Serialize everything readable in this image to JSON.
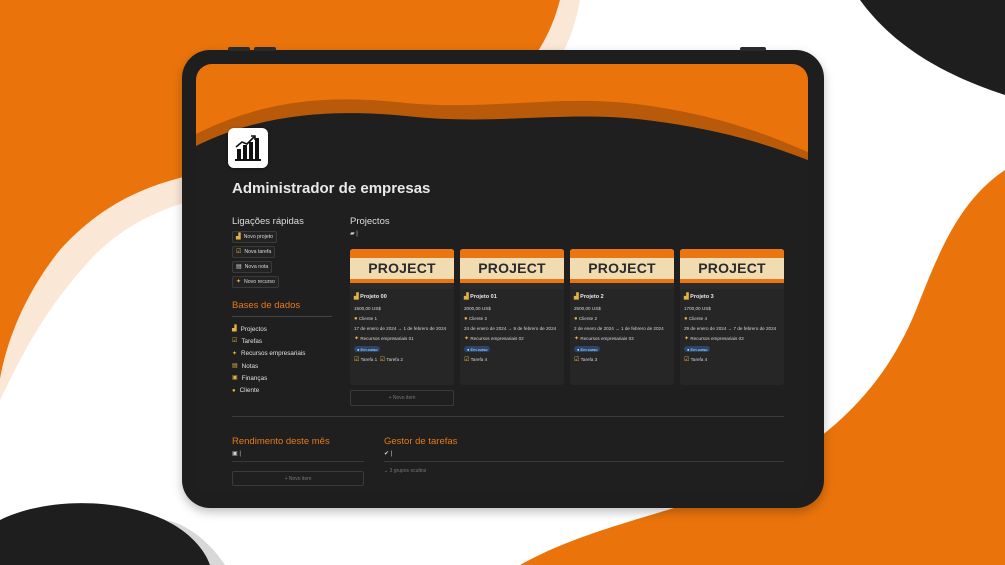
{
  "colors": {
    "accent": "#e77a1a",
    "orange_bg": "#ea740b",
    "dark": "#1e1e1e",
    "tag_blue": "#28456b"
  },
  "page": {
    "title": "Administrador de empresas"
  },
  "quick_links": {
    "title": "Ligações rápidas",
    "buttons": [
      {
        "label": "Novo projeto",
        "icon": "buildings-icon"
      },
      {
        "label": "Nova tarefa",
        "icon": "checkbox-icon"
      },
      {
        "label": "Nova nota",
        "icon": "note-icon"
      },
      {
        "label": "Novo recurso",
        "icon": "lightbulb-icon"
      }
    ]
  },
  "databases": {
    "title": "Bases de dados",
    "items": [
      {
        "label": "Projectos",
        "icon": "buildings-icon"
      },
      {
        "label": "Tarefas",
        "icon": "checkbox-icon"
      },
      {
        "label": "Recursos empresariais",
        "icon": "lightbulb-icon"
      },
      {
        "label": "Notas",
        "icon": "note-icon"
      },
      {
        "label": "Finanças",
        "icon": "money-icon"
      },
      {
        "label": "Cliente",
        "icon": "person-icon"
      }
    ]
  },
  "projects": {
    "title": "Projectos",
    "view_label": "|",
    "cover_text": "PROJECT",
    "new_item": "+ Novo item",
    "cards": [
      {
        "name": "Projeto 00",
        "price": "1500,00 US$",
        "client": "Cliente 1",
        "dates": "17 de enero de 2024 → 1 de febrero de 2024",
        "resource": "Recursos empresariais 01",
        "status": "Em curso",
        "tasks": [
          "Tarefa 1",
          "Tarefa 2"
        ]
      },
      {
        "name": "Projeto 01",
        "price": "2000,00 US$",
        "client": "Cliente 2",
        "dates": "24 de enero de 2024 → 9 de febrero de 2024",
        "resource": "Recursos empresariais 02",
        "status": "Em curso",
        "tasks": [
          "Tarefa 4"
        ]
      },
      {
        "name": "Projeto 2",
        "price": "2500,00 US$",
        "client": "Cliente 2",
        "dates": "2 de enero de 2024 → 1 de febrero de 2024",
        "resource": "Recursos empresariais 03",
        "status": "Em curso",
        "tasks": [
          "Tarefa 3"
        ]
      },
      {
        "name": "Projeto 3",
        "price": "1700,00 US$",
        "client": "Cliente 4",
        "dates": "29 de enero de 2024 → 7 de febrero de 2024",
        "resource": "Recursos empresariais 03",
        "status": "Em curso",
        "tasks": [
          "Tarefa 4"
        ]
      }
    ]
  },
  "performance": {
    "title": "Rendimento deste mês",
    "view_label": "|",
    "new_item": "+ Novo item"
  },
  "task_manager": {
    "title": "Gestor de tarefas",
    "view_label": "|",
    "hidden_groups": "3 grupos ocultos"
  }
}
